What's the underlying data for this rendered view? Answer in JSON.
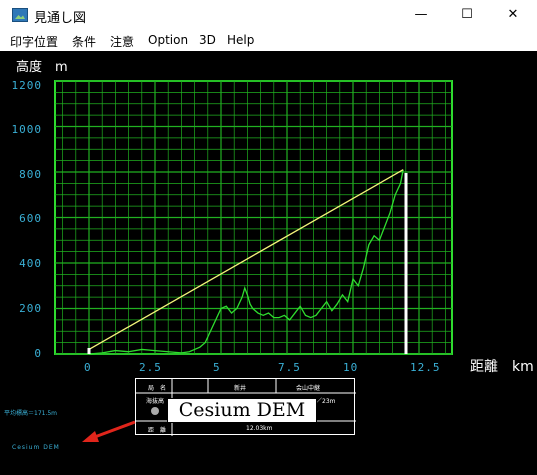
{
  "window": {
    "title": "見通し図",
    "controls": {
      "minimize": "—",
      "maximize": "☐",
      "close": "✕"
    }
  },
  "menu": [
    "印字位置",
    "条件",
    "注意",
    "Option",
    "3D",
    "Help"
  ],
  "chart": {
    "y_unit_label": "高度　m",
    "x_unit_label": "距離　km",
    "y_ticks": [
      "1200",
      "1000",
      "800",
      "600",
      "400",
      "200",
      "0"
    ],
    "x_ticks": [
      "0",
      "2.5",
      "5",
      "7.5",
      "10",
      "12.5"
    ],
    "info_table": {
      "row1": [
        "局　名",
        "新井",
        "会山中継"
      ],
      "row2_label": "海抜高",
      "row2_value": "／23m",
      "row4": [
        "距　離",
        "12.03km"
      ]
    },
    "callout_text": "Cesium DEM",
    "avg_elevation": "平均標高＝171.5m",
    "dem_source": "Cesium DEM"
  },
  "chart_data": {
    "type": "line",
    "xlabel": "距離 km",
    "ylabel": "高度 m",
    "xlim": [
      0,
      12.5
    ],
    "ylim": [
      0,
      1200
    ],
    "grid": true,
    "series": [
      {
        "x": [
          0,
          0.5,
          1.0,
          1.5,
          2.0,
          2.5,
          3.0,
          3.5,
          3.8,
          4.0,
          4.2,
          4.4,
          4.6,
          4.8,
          5.0,
          5.2,
          5.4,
          5.6,
          5.8,
          5.9,
          6.0,
          6.1,
          6.2,
          6.4,
          6.6,
          6.8,
          7.0,
          7.2,
          7.4,
          7.6,
          7.8,
          8.0,
          8.2,
          8.4,
          8.6,
          8.8,
          9.0,
          9.2,
          9.4,
          9.6,
          9.8,
          10.0,
          10.2,
          10.4,
          10.6,
          10.8,
          11.0,
          11.2,
          11.4,
          11.6,
          11.8,
          11.9
        ],
        "y": [
          0,
          5,
          15,
          10,
          20,
          15,
          10,
          5,
          10,
          20,
          30,
          50,
          100,
          150,
          200,
          210,
          180,
          200,
          250,
          290,
          260,
          220,
          200,
          180,
          170,
          180,
          160,
          160,
          170,
          150,
          180,
          210,
          170,
          160,
          170,
          200,
          230,
          190,
          220,
          260,
          230,
          330,
          300,
          380,
          480,
          520,
          500,
          560,
          620,
          700,
          750,
          810
        ]
      },
      {
        "x": [
          0,
          11.9
        ],
        "y": [
          20,
          810
        ]
      }
    ]
  }
}
